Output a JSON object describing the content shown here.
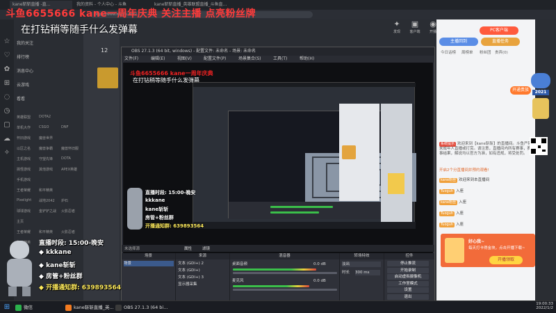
{
  "browser": {
    "tabs": [
      "kane斩斩直播 -直...",
      "我的资料 - 个人中心 - 斗鱼",
      "kane斩斩直播_英雄联盟直播_斗鱼直..."
    ],
    "url": "https://www.douyu.com/..."
  },
  "top_toolbar": [
    {
      "label": "发现",
      "icon": "discover-icon"
    },
    {
      "label": "客户端",
      "icon": "client-icon"
    },
    {
      "label": "开播",
      "icon": "broadcast-icon"
    },
    {
      "label": "个人",
      "icon": "user-icon"
    }
  ],
  "overlay": {
    "banner": "斗鱼6655666   kane一周年庆典   关注主播   点亮粉丝牌",
    "subtitle": "在打钻稍等随手什么发弹幕"
  },
  "left_nav": {
    "items": [
      "我的关注",
      "排行榜",
      "消息中心",
      "云游戏",
      "看看"
    ],
    "grid": [
      [
        "英雄联盟",
        "DOTA2"
      ],
      [
        "单机大作",
        "CSGO",
        "DNF"
      ],
      [
        "怀旧游戏",
        "魔兽世界"
      ],
      [
        "以区之名",
        "魔兽争霸",
        "魔兽怀旧服"
      ],
      [
        "主机游戏",
        "守望先锋",
        "DOTA"
      ],
      [
        "搞怪游戏",
        "其他游戏",
        "APEX英雄"
      ],
      [
        "手机游戏"
      ],
      [
        "王者荣耀",
        "和平精英"
      ],
      [
        "Pixelight",
        "战地2042",
        "炉石"
      ],
      [
        "球球游戏",
        "金铲铲之战",
        "火影忍者"
      ],
      [
        "主页"
      ],
      [
        "王者荣耀",
        "和平精英",
        "火影忍者"
      ],
      [
        "和平精英",
        "暗区突围"
      ]
    ],
    "count": "12"
  },
  "obs": {
    "title": "OBS 27.1.3 (64 bit, windows) - 配置文件: 未命名 - 场景: 未命名",
    "menu": [
      "文件(F)",
      "编辑(E)",
      "视图(V)",
      "配置文件(P)",
      "场景集合(S)",
      "工具(T)",
      "帮助(H)"
    ],
    "preview_banner": "斗鱼6655666  kane一周年庆典",
    "preview_sub": "在打钻稍等随手什么发弹幕",
    "scene_row_label": "未选择源",
    "scene_row_buttons": [
      "属性",
      "滤镜"
    ],
    "panels": {
      "scenes": {
        "title": "场景",
        "items": [
          "场景"
        ]
      },
      "sources": {
        "title": "来源",
        "items": [
          "文本 (GDI+) 2",
          "文本 (GDI+)",
          "文本 (GDI+) 3",
          "显示器采集"
        ]
      },
      "mixer": {
        "title": "混音器",
        "tracks": [
          {
            "name": "桌面音频",
            "db": "0.0 dB"
          },
          {
            "name": "麦克风",
            "db": "0.0 dB"
          }
        ]
      },
      "transitions": {
        "title": "转场特效",
        "type": "淡出",
        "duration_label": "时长",
        "duration": "300 ms"
      },
      "controls": {
        "title": "控件",
        "buttons": [
          "停止推流",
          "开始录制",
          "启动虚拟摄像机",
          "工作室模式",
          "设置",
          "退出"
        ]
      }
    }
  },
  "stream_overlay": {
    "schedule": "直播时段: 15:00-晚安",
    "qq_label": "kkkane",
    "weibo": "kane斩斩",
    "room": "房管+粉丝群",
    "fan_group": "开播通知群: 639893564"
  },
  "live_panel": {
    "tabs": [
      "主播回到",
      "直播任务"
    ],
    "subtabs": [
      "今日话榜",
      "周榜单",
      "粉丝团",
      "贵宾(0)"
    ],
    "rank_label": "开通贵族",
    "notice_badge": "系统提示",
    "notice": "欢迎来到【kane斩斩】的直播间。斗鱼严禁未成年人直播或打赏。请注意，直播间内所有赛事，赛事结果，解说均以官方为准，如有违规，将受处罚。",
    "ad_line": "开启2个分直播间并预约观看!",
    "chat": [
      {
        "user": "kane粉丝",
        "text": "欢迎来到本直播间"
      },
      {
        "user": "Tuoguh",
        "text": "入座"
      },
      {
        "user": "kane粉丝",
        "text": "入座"
      },
      {
        "user": "Tuoguh",
        "text": "入座"
      },
      {
        "user": "Tuoguh",
        "text": "入座"
      }
    ],
    "gift_card": {
      "title": "好心我~",
      "text": "每天打卡得金块，点击开播下载~",
      "cta": "开播领取"
    },
    "pc_label": "PC客户端",
    "year_badge": "2021"
  },
  "taskbar": {
    "start": "开始",
    "apps": [
      {
        "label": "微信",
        "color": "#2bb24c"
      },
      {
        "label": "kane斩斩直播_英...",
        "color": "#f47b20"
      },
      {
        "label": "OBS 27.1.3 (64 bi...",
        "color": "#3a3a3a"
      }
    ],
    "time": "19:00:33",
    "date": "2022/1/2"
  }
}
